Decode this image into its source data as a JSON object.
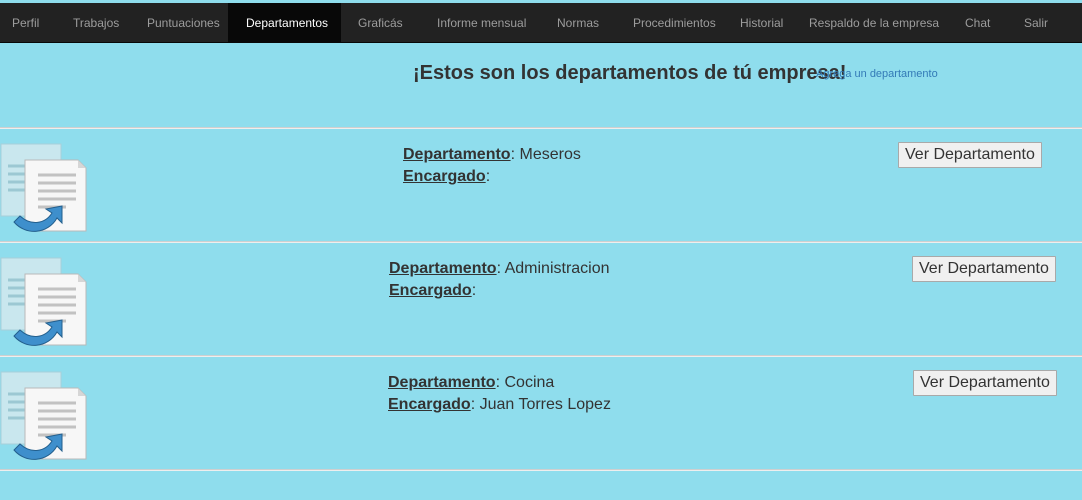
{
  "nav": {
    "items": [
      {
        "label": "Perfil",
        "active": false
      },
      {
        "label": "Trabajos",
        "active": false
      },
      {
        "label": "Puntuaciones",
        "active": false
      },
      {
        "label": "Departamentos",
        "active": true
      },
      {
        "label": "Graficás",
        "active": false
      },
      {
        "label": "Informe mensual",
        "active": false
      },
      {
        "label": "Normas",
        "active": false
      },
      {
        "label": "Procedimientos",
        "active": false
      },
      {
        "label": "Historial",
        "active": false
      },
      {
        "label": "Respaldo de la empresa",
        "active": false
      },
      {
        "label": "Chat",
        "active": false
      },
      {
        "label": "Salir",
        "active": false
      }
    ]
  },
  "header": {
    "title": "¡Estos son los departamentos de tú empresa!",
    "add_link": "Agrega un departamento"
  },
  "labels": {
    "department": "Departamento",
    "manager": "Encargado",
    "separator": ":"
  },
  "departments": [
    {
      "name": "Meseros",
      "manager": "",
      "button": "Ver Departamento"
    },
    {
      "name": "Administracion",
      "manager": "",
      "button": "Ver Departamento"
    },
    {
      "name": "Cocina",
      "manager": "Juan Torres Lopez",
      "button": "Ver Departamento"
    }
  ],
  "colors": {
    "background": "#8fdded",
    "navbar": "#222222",
    "nav_active": "#080808",
    "link": "#337ab7"
  },
  "icons": {
    "department": "document-copy-icon"
  }
}
